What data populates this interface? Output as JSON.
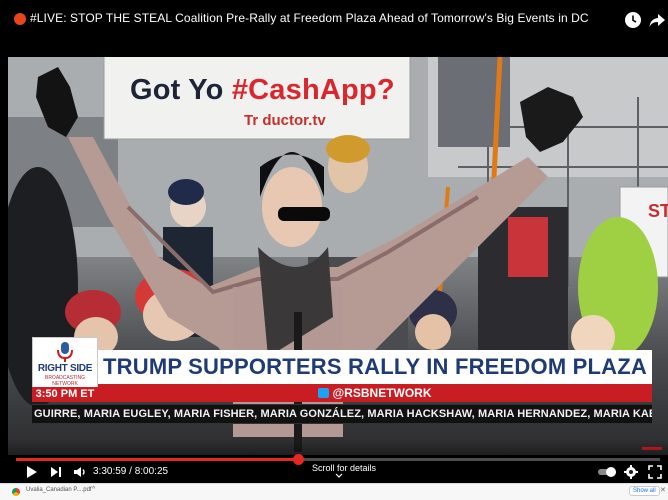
{
  "video": {
    "title": "#LIVE: STOP THE STEAL Coalition Pre-Rally at Freedom Plaza Ahead of Tomorrow's Big Events in DC",
    "live_indicator_color": "#e8451b",
    "header_icons": [
      "watch-later-icon",
      "share-icon"
    ]
  },
  "scene": {
    "sign_text_prefix": "Got Yo ",
    "sign_text_hashtag": "#CashApp?",
    "sign_url_fragment": "Tr     ductor.tv",
    "side_sign_fragment": "ST"
  },
  "lower_third": {
    "logo_line1": "RIGHT SIDE",
    "logo_line2": "BROADCASTING NETWORK",
    "time": "3:50 PM ET",
    "headline": "TRUMP SUPPORTERS RALLY IN FREEDOM PLAZA",
    "handle": "@RSBNETWORK",
    "ticker": "GUIRRE, MARIA EUGLEY, MARIA FISHER, MARIA GONZÁLEZ, MARIA HACKSHAW, MARIA HERNANDEZ, MARIA KABAKOW, M",
    "colors": {
      "red": "#c91d24",
      "navy": "#1f3b73"
    }
  },
  "player": {
    "current_time": "3:30:59",
    "duration": "8:00:25",
    "time_display": "3:30:59 / 8:00:25",
    "progress": 0.4381,
    "scroll_hint": "Scroll for details",
    "accent_color": "#e8271e",
    "controls": [
      "play-icon",
      "next-icon",
      "volume-icon",
      "autoplay-toggle",
      "settings-icon",
      "fullscreen-icon"
    ]
  },
  "download_bar": {
    "file_name": "Uvalia_Canadian P....pdf",
    "show_all": "Show all"
  }
}
